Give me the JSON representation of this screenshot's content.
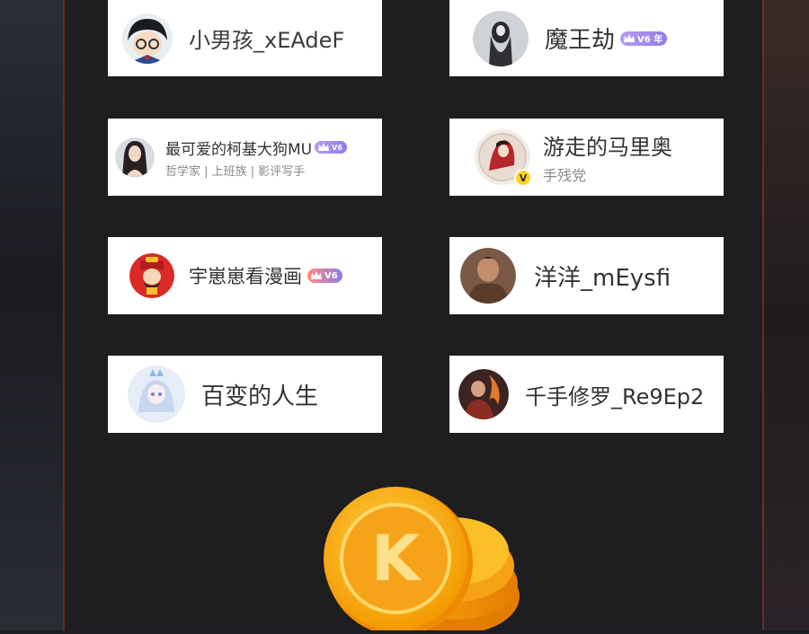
{
  "users": [
    {
      "name": "小男孩_xEAdeF",
      "subtitle": "",
      "badge": "",
      "avatar": "detective-avatar"
    },
    {
      "name": "魔王劫",
      "subtitle": "",
      "badge": "V6 年",
      "avatar": "ghost-avatar"
    },
    {
      "name": "最可爱的柯基大狗MU",
      "subtitle": "哲学家 | 上班族 | 影评写手",
      "badge": "V6",
      "avatar": "girl-avatar"
    },
    {
      "name": "游走的马里奥",
      "subtitle": "手残党",
      "badge": "V",
      "avatar": "anime-avatar"
    },
    {
      "name": "宇崽崽看漫画",
      "subtitle": "",
      "badge": "V6",
      "avatar": "fortune-god-avatar"
    },
    {
      "name": "洋洋_mEysfi",
      "subtitle": "",
      "badge": "",
      "avatar": "warrior-avatar"
    },
    {
      "name": "百变的人生",
      "subtitle": "",
      "badge": "",
      "avatar": "ice-princess-avatar"
    },
    {
      "name": "千手修罗_Re9Ep2",
      "subtitle": "",
      "badge": "",
      "avatar": "fire-figure-avatar"
    }
  ],
  "colors": {
    "accent": "#9b86ee",
    "coin": "#f7b500",
    "panel_border": "#6b2a22"
  },
  "coin_icon": "k-coin-stack-icon",
  "coin_letter": "K"
}
